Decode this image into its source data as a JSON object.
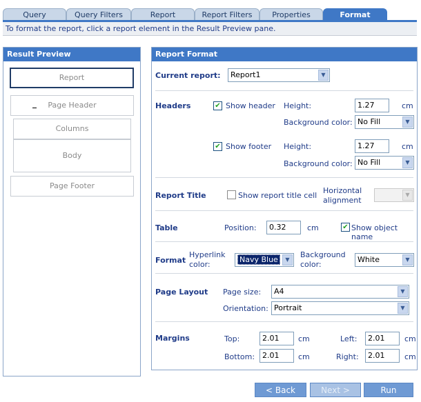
{
  "tabs": [
    "Query",
    "Query Filters",
    "Report",
    "Report Filters",
    "Properties",
    "Format"
  ],
  "info": "To format the report, click a report element in the Result Preview pane.",
  "preview": {
    "title": "Result Preview",
    "report": "Report",
    "page_header": "Page Header",
    "columns": "Columns",
    "body": "Body",
    "page_footer": "Page Footer"
  },
  "format": {
    "title": "Report Format",
    "current_report_label": "Current report:",
    "current_report_value": "Report1",
    "headers": {
      "section": "Headers",
      "show_header": "Show header",
      "show_footer": "Show footer",
      "height_label": "Height:",
      "header_height": "1.27",
      "footer_height": "1.27",
      "unit": "cm",
      "bg_label": "Background color:",
      "header_bg": "No Fill",
      "footer_bg": "No Fill"
    },
    "report_title": {
      "section": "Report Title",
      "show_title": "Show report title cell",
      "h_align_1": "Horizontal",
      "h_align_2": "alignment"
    },
    "table": {
      "section": "Table",
      "position_label": "Position:",
      "position": "0.32",
      "unit": "cm",
      "show_object_name": "Show object name"
    },
    "fmt": {
      "section": "Format",
      "hyperlink_1": "Hyperlink",
      "hyperlink_2": "color:",
      "hyperlink_value": "Navy Blue",
      "bg_1": "Background",
      "bg_2": "color:",
      "bg_value": "White"
    },
    "page_layout": {
      "section": "Page Layout",
      "size_label": "Page size:",
      "size": "A4",
      "orientation_label": "Orientation:",
      "orientation": "Portrait"
    },
    "margins": {
      "section": "Margins",
      "top_label": "Top:",
      "top": "2.01",
      "bottom_label": "Bottom:",
      "bottom": "2.01",
      "left_label": "Left:",
      "left": "2.01",
      "right_label": "Right:",
      "right": "2.01",
      "unit": "cm"
    }
  },
  "buttons": {
    "back": "< Back",
    "next": "Next >",
    "run": "Run"
  }
}
